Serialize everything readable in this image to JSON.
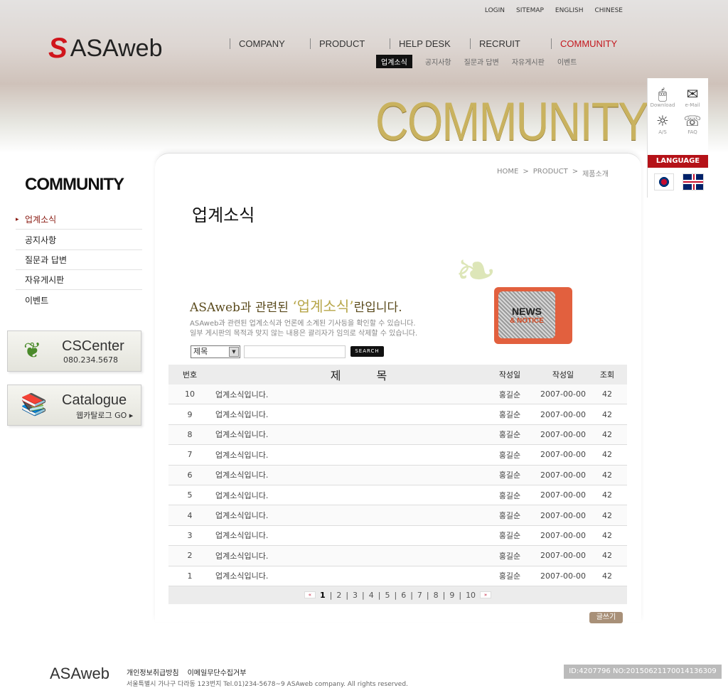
{
  "top_links": [
    "LOGIN",
    "SITEMAP",
    "ENGLISH",
    "CHINESE"
  ],
  "logo": {
    "mark": "S",
    "text": "ASAweb"
  },
  "nav": [
    "COMPANY",
    "PRODUCT",
    "HELP DESK",
    "RECRUIT",
    "COMMUNITY"
  ],
  "subnav": [
    "업계소식",
    "공지사항",
    "질문과 답변",
    "자유게시판",
    "이벤트"
  ],
  "hero_word": "COMMUNITY",
  "quick": [
    {
      "label": "Download",
      "icon": "mouse-icon"
    },
    {
      "label": "e-Mail",
      "icon": "mail-icon"
    },
    {
      "label": "A/S",
      "icon": "lightbulb-icon"
    },
    {
      "label": "FAQ",
      "icon": "phone-chat-icon"
    }
  ],
  "language": {
    "label": "LANGUAGE",
    "flags": [
      "korea-flag",
      "uk-flag"
    ]
  },
  "sidebar": {
    "title": "COMMUNITY",
    "items": [
      "업계소식",
      "공지사항",
      "질문과 답변",
      "자유게시판",
      "이벤트"
    ],
    "banners": [
      {
        "title": "CSCenter",
        "sub": "080.234.5678"
      },
      {
        "title": "Catalogue",
        "sub": "웹카탈로그 GO ▸"
      }
    ]
  },
  "breadcrumb": [
    "HOME",
    "PRODUCT",
    "제품소개"
  ],
  "page_title": "업계소식",
  "intro": {
    "pre": "ASAweb과 관련된 ",
    "quoted": "‘업계소식’",
    "post": "란입니다.",
    "line1": "ASAweb과 관련된 업계소식과 언론에 소계된 기사등을 확인할 수 있습니다.",
    "line2": "일부 게시판의 목적과 맞지 않는 내용은 괄리자가 임의로 삭제할 수 있습니다."
  },
  "tv": {
    "line1": "NEWS",
    "line2": "& NOTICE"
  },
  "search": {
    "select": "제목",
    "value": "",
    "button": "SEARCH"
  },
  "table": {
    "headers": [
      "번호",
      "제목",
      "작성일",
      "작성일",
      "조회"
    ],
    "rows": [
      [
        "10",
        "업계소식입니다.",
        "홍길순",
        "2007-00-00",
        "42"
      ],
      [
        "9",
        "업계소식입니다.",
        "홍길순",
        "2007-00-00",
        "42"
      ],
      [
        "8",
        "업계소식입니다.",
        "홍길순",
        "2007-00-00",
        "42"
      ],
      [
        "7",
        "업계소식입니다.",
        "홍길순",
        "2007-00-00",
        "42"
      ],
      [
        "6",
        "업계소식입니다.",
        "홍길순",
        "2007-00-00",
        "42"
      ],
      [
        "5",
        "업계소식입니다.",
        "홍길순",
        "2007-00-00",
        "42"
      ],
      [
        "4",
        "업계소식입니다.",
        "홍길순",
        "2007-00-00",
        "42"
      ],
      [
        "3",
        "업계소식입니다.",
        "홍길순",
        "2007-00-00",
        "42"
      ],
      [
        "2",
        "업계소식입니다.",
        "홍길순",
        "2007-00-00",
        "42"
      ],
      [
        "1",
        "업계소식입니다.",
        "홍길순",
        "2007-00-00",
        "42"
      ]
    ]
  },
  "pager": {
    "prev": "«",
    "next": "»",
    "pages": [
      "1",
      "2",
      "3",
      "4",
      "5",
      "6",
      "7",
      "8",
      "9",
      "10"
    ],
    "current": "1"
  },
  "write_button": "글쓰기",
  "footer": {
    "logo": "ASAweb",
    "links": [
      "개인정보취급방침",
      "이메일무단수집거부"
    ],
    "address": "서울특별시 가나구 다라동 123번지   Tel.01)234-5678~9  ASAweb company. All rights reserved."
  },
  "watermark": "ID:4207796 NO:20150621170014136309",
  "colors": {
    "accent": "#c3161c",
    "gold": "#c9b25f",
    "write": "#a89078"
  }
}
